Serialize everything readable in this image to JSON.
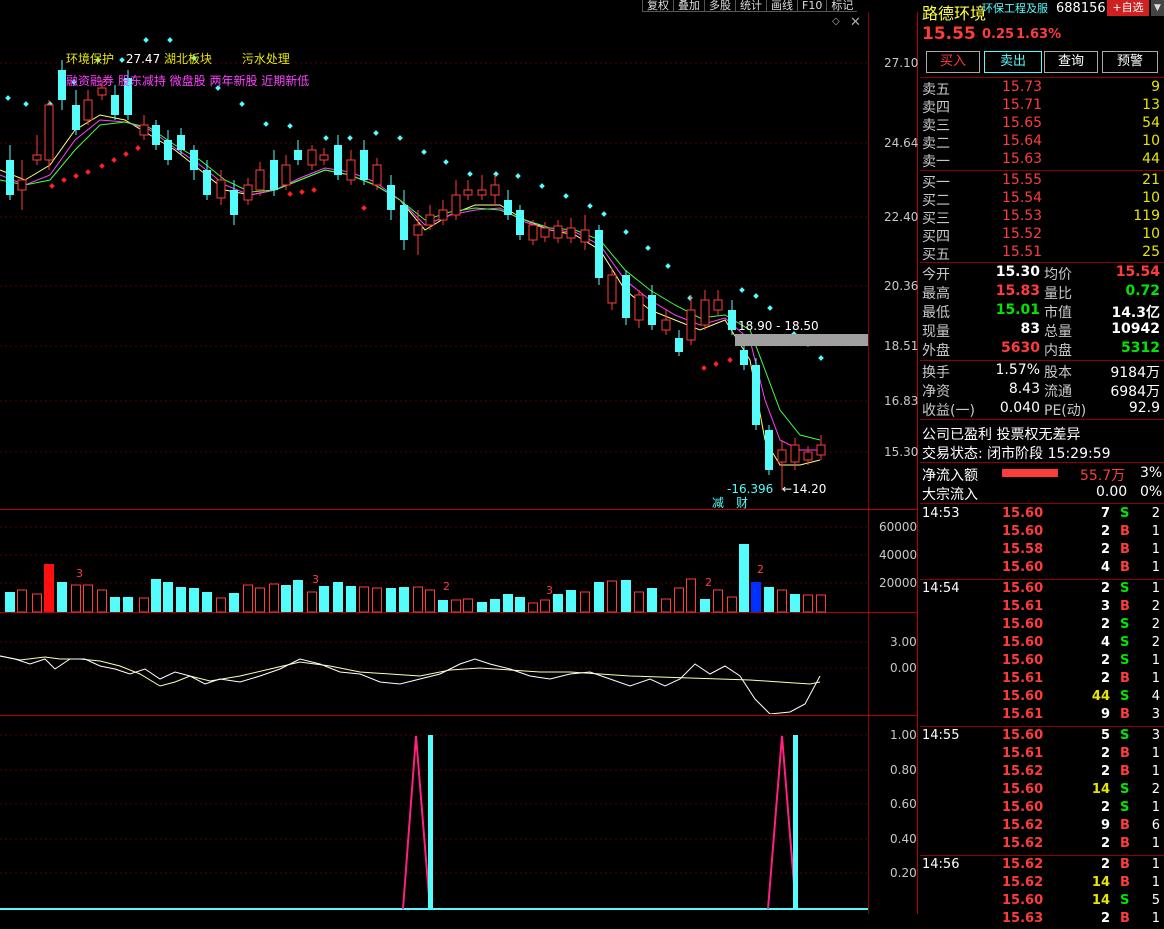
{
  "toolbar": [
    "复权",
    "叠加",
    "多股",
    "统计",
    "画线",
    "F10",
    "标记"
  ],
  "chart": {
    "price_axis": [
      "27.10",
      "24.64",
      "22.40",
      "20.36",
      "18.51",
      "16.83",
      "15.30"
    ],
    "vol_axis": [
      "60000",
      "40000",
      "20000"
    ],
    "osc_axis": [
      "3.00",
      "0.00"
    ],
    "ind_axis": [
      "1.00",
      "0.80",
      "0.60",
      "0.40",
      "0.20"
    ],
    "labels": {
      "high_price": "27.47",
      "low_price": "14.20",
      "range_label": "18.90 - 18.50",
      "neg_value": "-16.396",
      "tag_jian": "减",
      "tag_cai": "财",
      "vol_num": "3",
      "vol_num2": "2"
    },
    "concepts_line1": [
      "环境保护",
      "湖北板块",
      "污水处理"
    ],
    "concepts_line2": "融资融券 股东减持 微盘股 两年新股 近期新低"
  },
  "chart_data": {
    "type": "candlestick",
    "title": "",
    "price_ticks": [
      27.1,
      24.64,
      22.4,
      20.36,
      18.51,
      16.83,
      15.3
    ],
    "annotated_high": 27.47,
    "annotated_low": 14.2,
    "volume_ticks": [
      60000,
      40000,
      20000
    ],
    "osc_ticks": [
      3.0,
      0.0
    ],
    "indicator_ticks": [
      1.0,
      0.8,
      0.6,
      0.4,
      0.2
    ]
  },
  "panel": {
    "name": "路德环境",
    "sector": "环保工程及服",
    "code": "688156",
    "add_btn": "+自选",
    "price": "15.55",
    "change": "0.25",
    "pct": "1.63%",
    "buttons": [
      "买入",
      "卖出",
      "查询",
      "预警"
    ],
    "asks": [
      {
        "label": "卖五",
        "price": "15.73",
        "vol": "9"
      },
      {
        "label": "卖四",
        "price": "15.71",
        "vol": "13"
      },
      {
        "label": "卖三",
        "price": "15.65",
        "vol": "54"
      },
      {
        "label": "卖二",
        "price": "15.64",
        "vol": "10"
      },
      {
        "label": "卖一",
        "price": "15.63",
        "vol": "44"
      }
    ],
    "bids": [
      {
        "label": "买一",
        "price": "15.55",
        "vol": "21"
      },
      {
        "label": "买二",
        "price": "15.54",
        "vol": "10"
      },
      {
        "label": "买三",
        "price": "15.53",
        "vol": "119"
      },
      {
        "label": "买四",
        "price": "15.52",
        "vol": "10"
      },
      {
        "label": "买五",
        "price": "15.51",
        "vol": "25"
      }
    ],
    "stats": [
      {
        "l1": "今开",
        "v1": "15.30",
        "c1": "white",
        "l2": "均价",
        "v2": "15.54",
        "c2": "red"
      },
      {
        "l1": "最高",
        "v1": "15.83",
        "c1": "red",
        "l2": "量比",
        "v2": "0.72",
        "c2": "green"
      },
      {
        "l1": "最低",
        "v1": "15.01",
        "c1": "green",
        "l2": "市值",
        "v2": "14.3亿",
        "c2": "white"
      },
      {
        "l1": "现量",
        "v1": "83",
        "c1": "white",
        "l2": "总量",
        "v2": "10942",
        "c2": "white"
      },
      {
        "l1": "外盘",
        "v1": "5630",
        "c1": "red",
        "l2": "内盘",
        "v2": "5312",
        "c2": "green"
      }
    ],
    "stats2": [
      {
        "l1": "换手",
        "v1": "1.57%",
        "l2": "股本",
        "v2": "9184万"
      },
      {
        "l1": "净资",
        "v1": "8.43",
        "l2": "流通",
        "v2": "6984万"
      },
      {
        "l1": "收益(一)",
        "v1": "0.040",
        "l2": "PE(动)",
        "v2": "92.9"
      }
    ],
    "profit_line": "公司已盈利 投票权无差异",
    "status_label": "交易状态:",
    "status_value": "闭市阶段",
    "status_time": "15:29:59",
    "netflow_label": "净流入额",
    "netflow_value": "55.7万",
    "netflow_pct": "3%",
    "block_label": "大宗流入",
    "block_value": "0.00",
    "block_pct": "0%"
  },
  "trades": [
    {
      "time": "14:53",
      "price": "15.60",
      "vol": "7",
      "bs": "S",
      "n": "2"
    },
    {
      "time": "",
      "price": "15.60",
      "vol": "2",
      "bs": "B",
      "n": "1"
    },
    {
      "time": "",
      "price": "15.58",
      "vol": "2",
      "bs": "B",
      "n": "1"
    },
    {
      "time": "",
      "price": "15.60",
      "vol": "4",
      "bs": "B",
      "n": "1"
    },
    {
      "time": "14:54",
      "price": "15.60",
      "vol": "2",
      "bs": "S",
      "n": "1"
    },
    {
      "time": "",
      "price": "15.61",
      "vol": "3",
      "bs": "B",
      "n": "2"
    },
    {
      "time": "",
      "price": "15.60",
      "vol": "2",
      "bs": "S",
      "n": "2"
    },
    {
      "time": "",
      "price": "15.60",
      "vol": "4",
      "bs": "S",
      "n": "2"
    },
    {
      "time": "",
      "price": "15.60",
      "vol": "2",
      "bs": "S",
      "n": "1"
    },
    {
      "time": "",
      "price": "15.61",
      "vol": "2",
      "bs": "B",
      "n": "1"
    },
    {
      "time": "",
      "price": "15.60",
      "vol": "44",
      "bs": "S",
      "n": "4"
    },
    {
      "time": "",
      "price": "15.61",
      "vol": "9",
      "bs": "B",
      "n": "3"
    },
    {
      "time": "14:55",
      "price": "15.60",
      "vol": "5",
      "bs": "S",
      "n": "3"
    },
    {
      "time": "",
      "price": "15.61",
      "vol": "2",
      "bs": "B",
      "n": "1"
    },
    {
      "time": "",
      "price": "15.62",
      "vol": "2",
      "bs": "B",
      "n": "1"
    },
    {
      "time": "",
      "price": "15.60",
      "vol": "14",
      "bs": "S",
      "n": "2"
    },
    {
      "time": "",
      "price": "15.60",
      "vol": "2",
      "bs": "S",
      "n": "1"
    },
    {
      "time": "",
      "price": "15.62",
      "vol": "9",
      "bs": "B",
      "n": "6"
    },
    {
      "time": "",
      "price": "15.62",
      "vol": "2",
      "bs": "B",
      "n": "1"
    },
    {
      "time": "14:56",
      "price": "15.62",
      "vol": "2",
      "bs": "B",
      "n": "1"
    },
    {
      "time": "",
      "price": "15.62",
      "vol": "14",
      "bs": "B",
      "n": "1"
    },
    {
      "time": "",
      "price": "15.60",
      "vol": "14",
      "bs": "S",
      "n": "5"
    },
    {
      "time": "",
      "price": "15.63",
      "vol": "2",
      "bs": "B",
      "n": "1"
    }
  ]
}
